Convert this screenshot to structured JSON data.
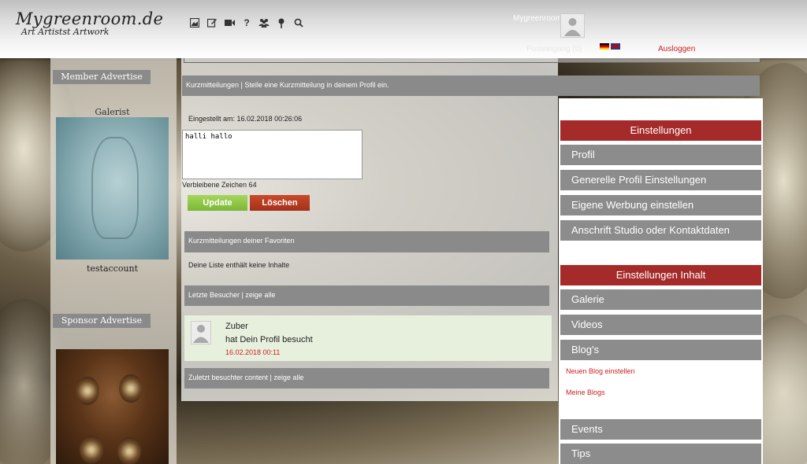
{
  "header": {
    "logo_title": "Mygreenroom.de",
    "logo_subtitle": "Art Artistst Artwork",
    "icons": [
      "image-icon",
      "edit-icon",
      "video-icon",
      "help-icon",
      "group-icon",
      "pin-icon",
      "search-icon"
    ],
    "user_name": "Mygreenroom",
    "postein_label": "Posteingang (0)",
    "logout_label": "Ausloggen"
  },
  "left": {
    "member_advertise": "Member Advertise",
    "galerist": "Galerist",
    "member_name": "testaccount",
    "sponsor_advertise": "Sponsor Advertise"
  },
  "main": {
    "top_bar": "Kurzmitteilungen | Stelle eine Kurzmitteilung in deinem Profil ein.",
    "eingestellt": "Eingestellt am: 16.02.2018 00:26:06",
    "message_value": "halli hallo",
    "remaining": "Verbleibene Zeichen 64",
    "update_label": "Update",
    "delete_label": "Löschen",
    "favorites_bar": "Kurzmitteilungen deiner Favoriten",
    "empty_list": "Deine Liste enthält keine Inhalte",
    "visitors_bar": "Letzte Besucher | zeige alle",
    "visitor": {
      "name": "Zuber",
      "text": "hat Dein Profil besucht",
      "date": "16.02.2018 00:11"
    },
    "content_bar": "Zuletzt besuchter content | zeige alle"
  },
  "right": {
    "settings_head": "Einstellungen",
    "settings_items": [
      "Profil",
      "Generelle Profil Einstellungen",
      "Eigene Werbung einstellen",
      "Anschrift Studio oder Kontaktdaten"
    ],
    "content_head": "Einstellungen Inhalt",
    "content_items": [
      "Galerie",
      "Videos",
      "Blog's"
    ],
    "blog_links": [
      "Neuen Blog einstellen",
      "Meine Blogs"
    ],
    "more_items": [
      "Events",
      "Tips"
    ]
  },
  "colors": {
    "bar_gray": "#8a8a8a",
    "accent_red": "#a52a2a",
    "link_red": "#cc2222",
    "update_green": "#7ab835",
    "visitor_bg": "#e7f0dd"
  }
}
